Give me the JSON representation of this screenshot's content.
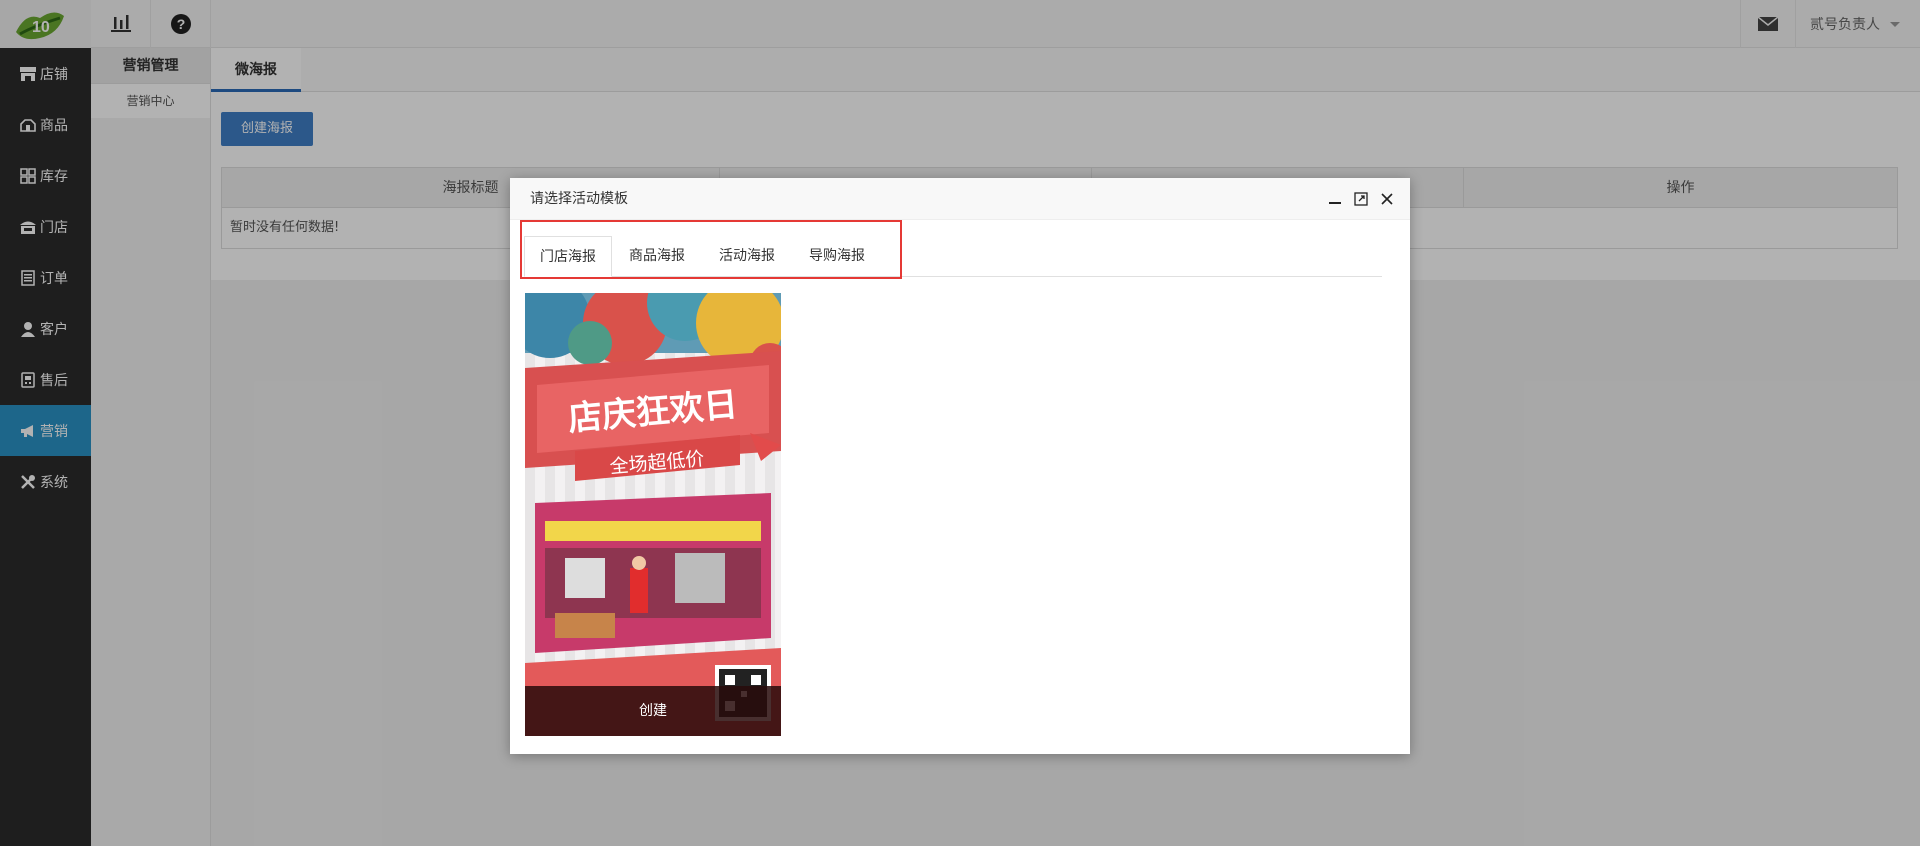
{
  "topbar": {
    "logo_text": "10",
    "icons": [
      "bar-chart-icon",
      "help-icon"
    ],
    "mail_icon": "mail-icon",
    "user_name": "贰号负责人"
  },
  "sidebar": {
    "items": [
      {
        "label": "店铺",
        "icon": "store-icon",
        "active": false
      },
      {
        "label": "商品",
        "icon": "goods-icon",
        "active": false
      },
      {
        "label": "库存",
        "icon": "inventory-icon",
        "active": false
      },
      {
        "label": "门店",
        "icon": "shop-icon",
        "active": false
      },
      {
        "label": "订单",
        "icon": "order-icon",
        "active": false
      },
      {
        "label": "客户",
        "icon": "customer-icon",
        "active": false
      },
      {
        "label": "售后",
        "icon": "aftersale-icon",
        "active": false
      },
      {
        "label": "营销",
        "icon": "megaphone-icon",
        "active": true
      },
      {
        "label": "系统",
        "icon": "tools-icon",
        "active": false
      }
    ],
    "active_color": "#2a93c6"
  },
  "subnav": {
    "title": "营销管理",
    "items": [
      "营销中心"
    ]
  },
  "main": {
    "tab": "微海报",
    "create_button": "创建海报",
    "table": {
      "columns": [
        "海报标题",
        "",
        "",
        "操作"
      ],
      "empty_text": "暂时没有任何数据!"
    }
  },
  "modal": {
    "title": "请选择活动模板",
    "controls": [
      "minimize-icon",
      "maximize-icon",
      "close-icon"
    ],
    "tabs": [
      {
        "label": "门店海报",
        "active": true
      },
      {
        "label": "商品海报",
        "active": false
      },
      {
        "label": "活动海报",
        "active": false
      },
      {
        "label": "导购海报",
        "active": false
      }
    ],
    "highlight_color": "#e53935",
    "template": {
      "headline": "店庆狂欢日",
      "subline": "全场超低价",
      "create_label": "创建"
    }
  }
}
